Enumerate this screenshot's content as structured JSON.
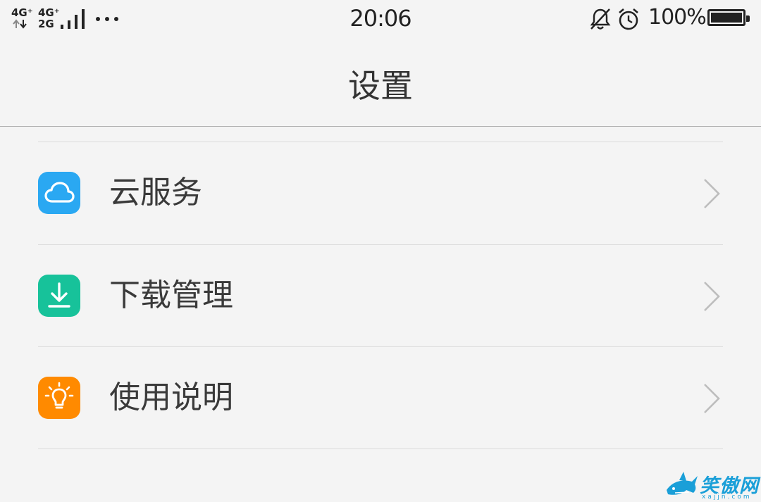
{
  "status_bar": {
    "sim1": "4G⁺",
    "sim2_top": "4G⁺",
    "sim2_bottom": "2G",
    "time": "20:06",
    "battery_percent": "100%",
    "battery_level": 1.0,
    "icons": [
      "data-arrows-icon",
      "signal-bars-icon",
      "more-dots-icon",
      "bell-muted-icon",
      "alarm-clock-icon",
      "battery-icon"
    ]
  },
  "header": {
    "title": "设置"
  },
  "settings": {
    "items": [
      {
        "label": "云服务",
        "icon": "cloud-icon",
        "icon_color": "#2aa8f2"
      },
      {
        "label": "下载管理",
        "icon": "download-icon",
        "icon_color": "#17c29a"
      },
      {
        "label": "使用说明",
        "icon": "lightbulb-icon",
        "icon_color": "#ff8a00"
      }
    ]
  },
  "watermark": {
    "text": "笑傲网",
    "url": "xajjn.com"
  }
}
